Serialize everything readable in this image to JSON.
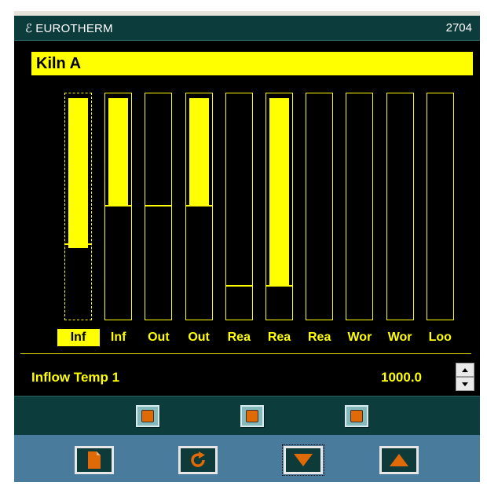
{
  "titlebar": {
    "brand": "EUROTHERM",
    "logo_glyph": "ℰ",
    "model": "2704"
  },
  "screen": {
    "title": "Kiln A",
    "bars": [
      {
        "label": "Inf",
        "fill_top_pct": 0.01,
        "fill_bottom_pct": 0.67,
        "marker_pct": 0.66,
        "selected": true
      },
      {
        "label": "Inf",
        "fill_top_pct": 0.01,
        "fill_bottom_pct": 0.48,
        "marker_pct": 0.49,
        "selected": false
      },
      {
        "label": "Out",
        "fill_top_pct": null,
        "fill_bottom_pct": null,
        "marker_pct": 0.49,
        "selected": false
      },
      {
        "label": "Out",
        "fill_top_pct": 0.01,
        "fill_bottom_pct": 0.48,
        "marker_pct": 0.49,
        "selected": false
      },
      {
        "label": "Rea",
        "fill_top_pct": null,
        "fill_bottom_pct": null,
        "marker_pct": 0.84,
        "selected": false
      },
      {
        "label": "Rea",
        "fill_top_pct": 0.01,
        "fill_bottom_pct": 0.83,
        "marker_pct": 0.84,
        "selected": false
      },
      {
        "label": "Rea",
        "fill_top_pct": null,
        "fill_bottom_pct": null,
        "marker_pct": null,
        "selected": false
      },
      {
        "label": "Wor",
        "fill_top_pct": null,
        "fill_bottom_pct": null,
        "marker_pct": null,
        "selected": false
      },
      {
        "label": "Wor",
        "fill_top_pct": null,
        "fill_bottom_pct": null,
        "marker_pct": null,
        "selected": false
      },
      {
        "label": "Loo",
        "fill_top_pct": null,
        "fill_bottom_pct": null,
        "marker_pct": null,
        "selected": false
      }
    ],
    "parameter": {
      "name": "Inflow Temp 1",
      "value": "1000.0"
    }
  },
  "buttons_row1": [
    "function-key-1",
    "function-key-2",
    "function-key-3"
  ],
  "buttons_row2": [
    {
      "name": "page-button",
      "icon": "page-icon"
    },
    {
      "name": "scroll-button",
      "icon": "refresh-icon"
    },
    {
      "name": "lower-button",
      "icon": "down-triangle-icon"
    },
    {
      "name": "raise-button",
      "icon": "up-triangle-icon"
    }
  ],
  "colors": {
    "display_background": "#000000",
    "display_foreground": "#ffff00",
    "bezel": "#0c3c3b",
    "keypad": "#497c9c",
    "key_accent": "#e06a06"
  }
}
